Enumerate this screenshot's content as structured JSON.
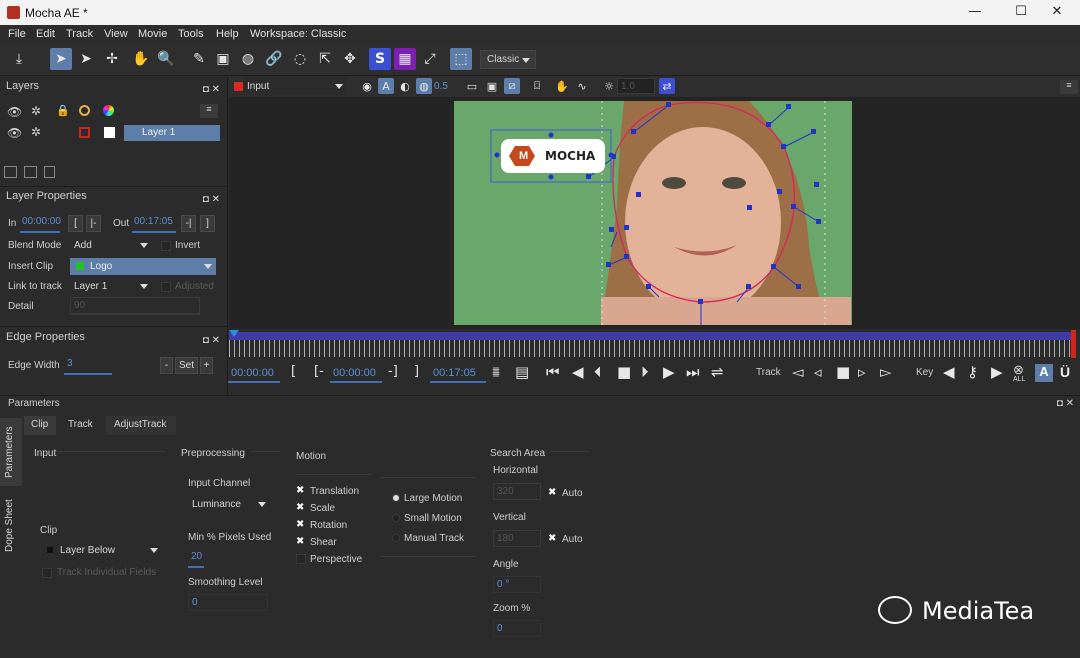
{
  "window": {
    "title": "Mocha AE *",
    "minimize": "—",
    "maximize": "☐",
    "close": "✕"
  },
  "menu": [
    "File",
    "Edit",
    "Track",
    "View",
    "Movie",
    "Tools",
    "Help",
    "Workspace: Classic"
  ],
  "toolbar": {
    "workspace": "Classic",
    "opacity_value": "0.5",
    "zoom_value": "1.0",
    "layer_input": "Input"
  },
  "layers_panel": {
    "title": "Layers",
    "layer_name": "Layer 1",
    "layer_color": "#c8271e"
  },
  "layer_properties": {
    "title": "Layer Properties",
    "in_label": "In",
    "in_value": "00:00:00",
    "out_label": "Out",
    "out_value": "00:17:05",
    "blend_label": "Blend Mode",
    "blend_value": "Add",
    "invert_label": "Invert",
    "insert_label": "Insert Clip",
    "insert_value": "Logo",
    "insert_color": "#22c02a",
    "link_label": "Link to track",
    "link_value": "Layer 1",
    "adjusted_label": "Adjusted",
    "detail_label": "Detail",
    "detail_value": "90"
  },
  "edge_properties": {
    "title": "Edge Properties",
    "width_label": "Edge Width",
    "width_value": "3",
    "minus": "-",
    "set": "Set",
    "plus": "+"
  },
  "logo": {
    "text": "MOCHA",
    "mark": "M"
  },
  "transport": {
    "current": "00:00:00",
    "in": "00:00:00",
    "out": "00:17:05",
    "bracket_open": "[",
    "bracket_in": "[-",
    "bracket_out": "-]",
    "bracket_close": "]",
    "track_label": "Track",
    "key_label": "Key",
    "all_label": "ALL",
    "a_label": "A",
    "u_label": "Ü"
  },
  "parameters": {
    "title": "Parameters",
    "side_tabs": [
      "Parameters",
      "Dope Sheet"
    ],
    "tabs": [
      "Clip",
      "Track",
      "AdjustTrack"
    ],
    "input_label": "Input",
    "clip_label": "Clip",
    "clip_value": "Layer Below",
    "track_fields_label": "Track Individual Fields",
    "preprocessing_label": "Preprocessing",
    "input_channel_label": "Input Channel",
    "input_channel_value": "Luminance",
    "min_pixels_label": "Min % Pixels Used",
    "min_pixels_value": "20",
    "smoothing_label": "Smoothing Level",
    "smoothing_value": "0",
    "motion_label": "Motion",
    "motion_options": [
      "Translation",
      "Scale",
      "Rotation",
      "Shear",
      "Perspective"
    ],
    "motion_checked": [
      true,
      true,
      true,
      true,
      false
    ],
    "motion_modes": [
      "Large Motion",
      "Small Motion",
      "Manual Track"
    ],
    "search_area_label": "Search Area",
    "horizontal_label": "Horizontal",
    "horizontal_value": "320",
    "vertical_label": "Vertical",
    "vertical_value": "180",
    "auto_label": "Auto",
    "angle_label": "Angle",
    "angle_value": "0 °",
    "zoom_label": "Zoom %",
    "zoom_value": "0"
  },
  "watermark": "MediaTea"
}
